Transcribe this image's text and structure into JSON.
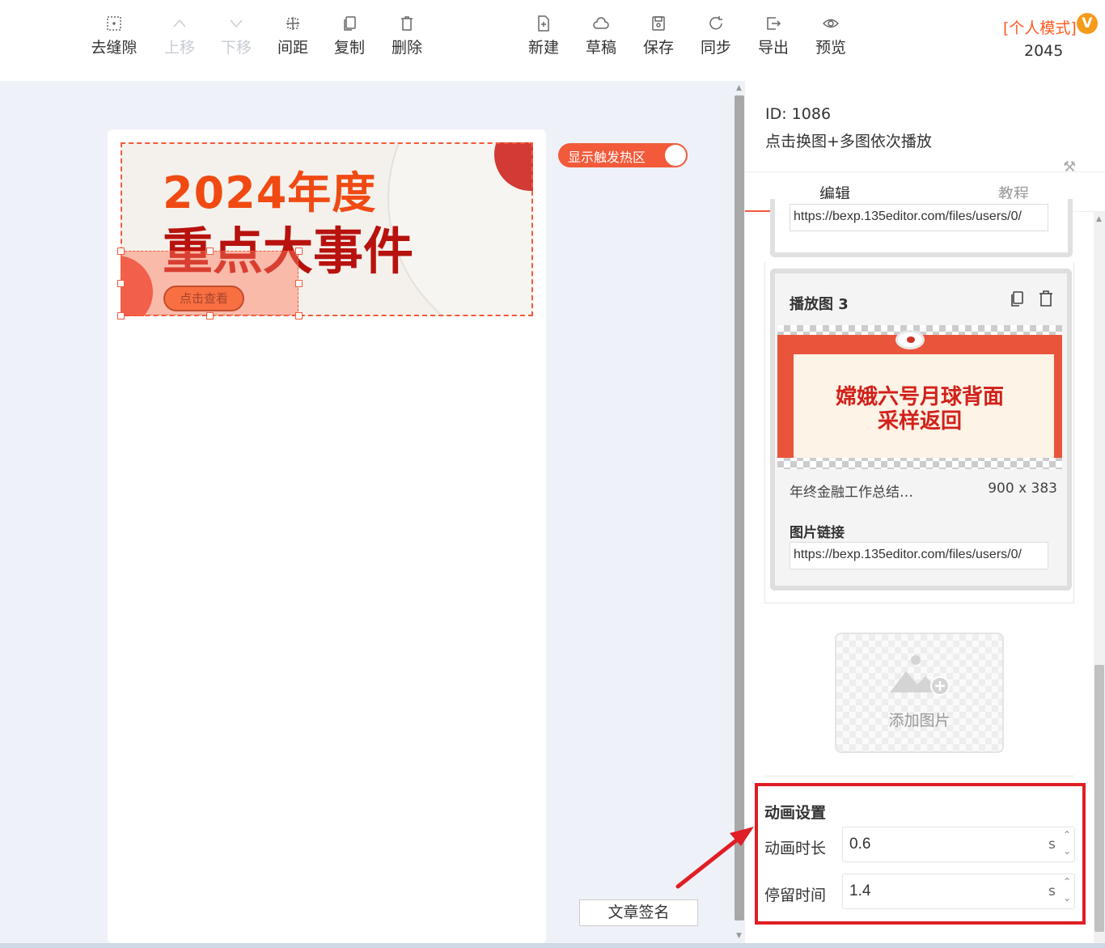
{
  "toolbar": {
    "left_tools": [
      {
        "label": "去缝隙",
        "icon": "grid-icon",
        "disabled": false
      },
      {
        "label": "上移",
        "icon": "chevron-up-icon",
        "disabled": true
      },
      {
        "label": "下移",
        "icon": "chevron-down-icon",
        "disabled": true
      },
      {
        "label": "间距",
        "icon": "spacing-icon",
        "disabled": false
      },
      {
        "label": "复制",
        "icon": "copy-icon",
        "disabled": false
      },
      {
        "label": "删除",
        "icon": "trash-icon",
        "disabled": false
      }
    ],
    "right_tools": [
      {
        "label": "新建",
        "icon": "new-file-icon"
      },
      {
        "label": "草稿",
        "icon": "cloud-icon"
      },
      {
        "label": "保存",
        "icon": "save-icon"
      },
      {
        "label": "同步",
        "icon": "sync-icon"
      },
      {
        "label": "导出",
        "icon": "export-icon"
      },
      {
        "label": "预览",
        "icon": "eye-icon"
      }
    ],
    "mode_label": "[个人模式]",
    "vip_badge": "V",
    "count": "2045"
  },
  "canvas": {
    "banner": {
      "title_line1": "2024年度",
      "title_line2": "重点大事件",
      "button_text": "点击查看"
    },
    "hotzone_toggle_label": "显示触发热区",
    "signature_button": "文章签名"
  },
  "panel": {
    "id_text": "ID: 1086",
    "description": "点击换图+多图依次播放",
    "tabs": [
      {
        "label": "编辑",
        "active": true
      },
      {
        "label": "教程",
        "active": false
      }
    ],
    "prev_card_url": "https://bexp.135editor.com/files/users/0/",
    "card": {
      "title": "播放图 3",
      "image_text_line1": "嫦娥六号月球背面",
      "image_text_line2": "采样返回",
      "image_name": "年终金融工作总结…",
      "image_size": "900 x 383",
      "link_label": "图片链接",
      "link_value": "https://bexp.135editor.com/files/users/0/"
    },
    "add_image_label": "添加图片",
    "animation": {
      "title": "动画设置",
      "duration_label": "动画时长",
      "duration_value": "0.6",
      "duration_unit": "s",
      "stay_label": "停留时间",
      "stay_value": "1.4",
      "stay_unit": "s"
    }
  },
  "colors": {
    "accent": "#f25a3a",
    "highlight_box": "#e01e25",
    "vip": "#f49b1a"
  }
}
